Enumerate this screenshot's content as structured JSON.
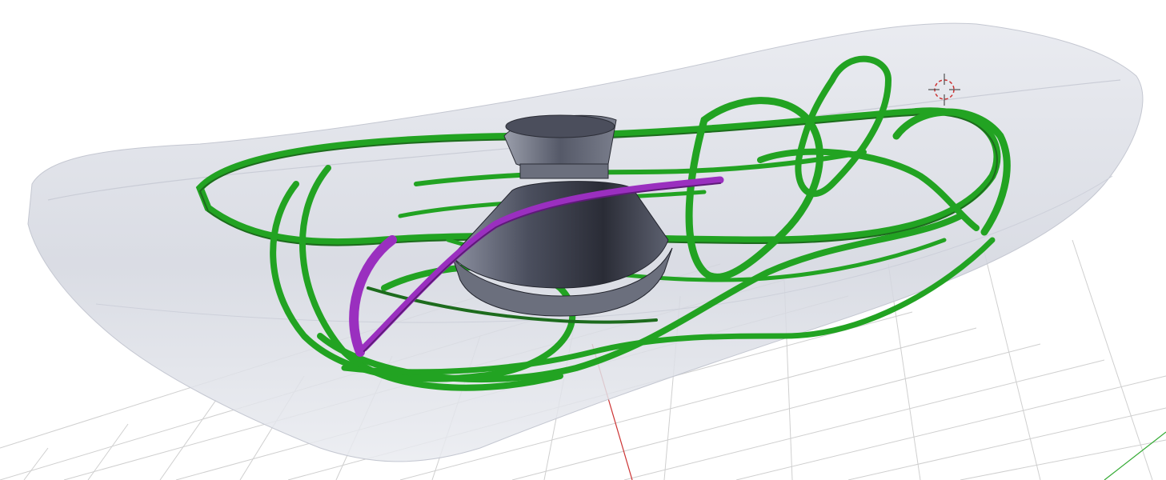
{
  "viewport": {
    "background": "#ffffff",
    "grid_color": "#cfcfcf",
    "x_axis_color": "#cc3333",
    "y_axis_color": "#33aa33"
  },
  "scene": {
    "vessel": {
      "color": "#d7dae3"
    },
    "impeller": {
      "color": "#3e4150"
    },
    "ribbons": {
      "primary_color": "#22a322",
      "dark_color": "#1d6b1d",
      "highlight_color": "#9a2fbf"
    },
    "cursor_icon": "3d-cursor-crosshair"
  }
}
